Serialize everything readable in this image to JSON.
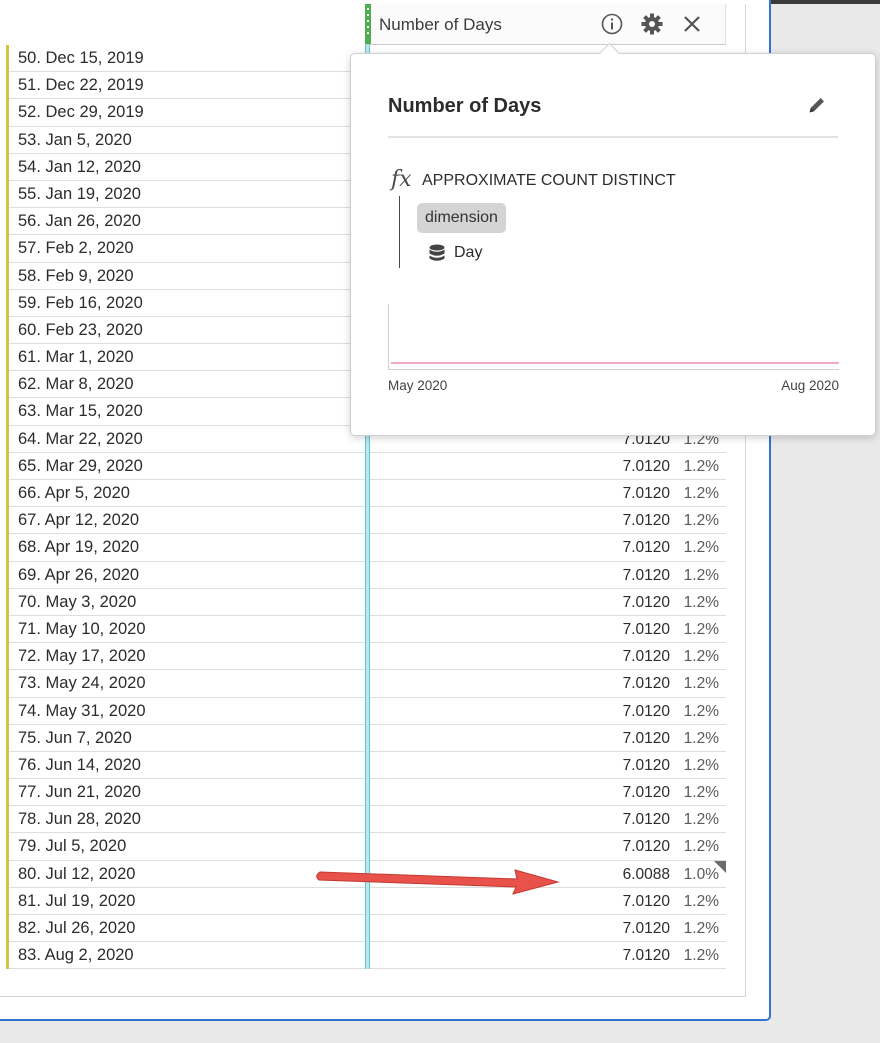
{
  "column": {
    "title": "Number of Days"
  },
  "rows": [
    {
      "label": "50. Dec 15, 2019",
      "value": "",
      "pct": ""
    },
    {
      "label": "51. Dec 22, 2019",
      "value": "",
      "pct": ""
    },
    {
      "label": "52. Dec 29, 2019",
      "value": "",
      "pct": ""
    },
    {
      "label": "53. Jan 5, 2020",
      "value": "",
      "pct": ""
    },
    {
      "label": "54. Jan 12, 2020",
      "value": "",
      "pct": ""
    },
    {
      "label": "55. Jan 19, 2020",
      "value": "",
      "pct": ""
    },
    {
      "label": "56. Jan 26, 2020",
      "value": "",
      "pct": ""
    },
    {
      "label": "57. Feb 2, 2020",
      "value": "",
      "pct": ""
    },
    {
      "label": "58. Feb 9, 2020",
      "value": "",
      "pct": ""
    },
    {
      "label": "59. Feb 16, 2020",
      "value": "",
      "pct": ""
    },
    {
      "label": "60. Feb 23, 2020",
      "value": "",
      "pct": ""
    },
    {
      "label": "61. Mar 1, 2020",
      "value": "",
      "pct": ""
    },
    {
      "label": "62. Mar 8, 2020",
      "value": "",
      "pct": ""
    },
    {
      "label": "63. Mar 15, 2020",
      "value": "",
      "pct": ""
    },
    {
      "label": "64. Mar 22, 2020",
      "value": "7.0120",
      "pct": "1.2%"
    },
    {
      "label": "65. Mar 29, 2020",
      "value": "7.0120",
      "pct": "1.2%"
    },
    {
      "label": "66. Apr 5, 2020",
      "value": "7.0120",
      "pct": "1.2%"
    },
    {
      "label": "67. Apr 12, 2020",
      "value": "7.0120",
      "pct": "1.2%"
    },
    {
      "label": "68. Apr 19, 2020",
      "value": "7.0120",
      "pct": "1.2%"
    },
    {
      "label": "69. Apr 26, 2020",
      "value": "7.0120",
      "pct": "1.2%"
    },
    {
      "label": "70. May 3, 2020",
      "value": "7.0120",
      "pct": "1.2%"
    },
    {
      "label": "71. May 10, 2020",
      "value": "7.0120",
      "pct": "1.2%"
    },
    {
      "label": "72. May 17, 2020",
      "value": "7.0120",
      "pct": "1.2%"
    },
    {
      "label": "73. May 24, 2020",
      "value": "7.0120",
      "pct": "1.2%"
    },
    {
      "label": "74. May 31, 2020",
      "value": "7.0120",
      "pct": "1.2%"
    },
    {
      "label": "75. Jun 7, 2020",
      "value": "7.0120",
      "pct": "1.2%"
    },
    {
      "label": "76. Jun 14, 2020",
      "value": "7.0120",
      "pct": "1.2%"
    },
    {
      "label": "77. Jun 21, 2020",
      "value": "7.0120",
      "pct": "1.2%"
    },
    {
      "label": "78. Jun 28, 2020",
      "value": "7.0120",
      "pct": "1.2%"
    },
    {
      "label": "79. Jul 5, 2020",
      "value": "7.0120",
      "pct": "1.2%"
    },
    {
      "label": "80. Jul 12, 2020",
      "value": "6.0088",
      "pct": "1.0%",
      "flagged": true
    },
    {
      "label": "81. Jul 19, 2020",
      "value": "7.0120",
      "pct": "1.2%"
    },
    {
      "label": "82. Jul 26, 2020",
      "value": "7.0120",
      "pct": "1.2%"
    },
    {
      "label": "83. Aug 2, 2020",
      "value": "7.0120",
      "pct": "1.2%"
    }
  ],
  "popup": {
    "title": "Number of Days",
    "function_icon": "fx",
    "function": "APPROXIMATE COUNT DISTINCT",
    "argument_chip": "dimension",
    "dimension": "Day",
    "axis_start": "May 2020",
    "axis_end": "Aug 2020"
  },
  "icons": {
    "info": "info-icon",
    "settings": "gear-icon",
    "close": "close-icon",
    "edit": "pencil-icon",
    "dimension": "database-icon"
  },
  "colors": {
    "row_accent": "#d4c245",
    "column_divider": "#5fc6cf",
    "grip": "#4caf50",
    "sparkline": "#f0a8c8",
    "annotation_arrow": "#e8524a",
    "card_border": "#2f74d0"
  }
}
